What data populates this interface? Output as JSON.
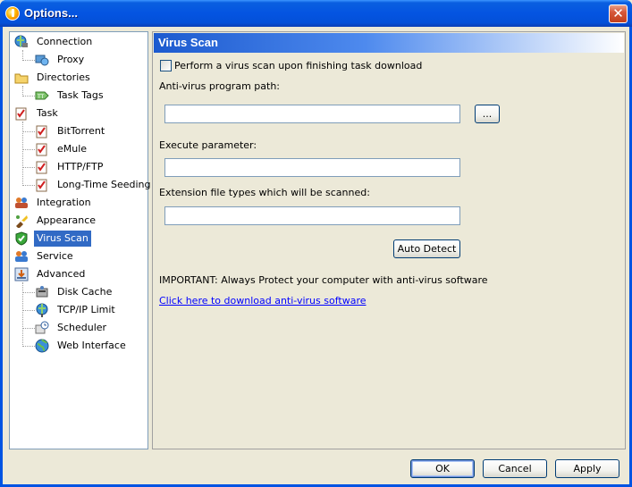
{
  "window": {
    "title": "Options..."
  },
  "tree": {
    "items": [
      {
        "label": "Connection",
        "icon": "connection-icon"
      },
      {
        "label": "Proxy",
        "icon": "proxy-icon"
      },
      {
        "label": "Directories",
        "icon": "folder-icon"
      },
      {
        "label": "Task Tags",
        "icon": "tag-icon"
      },
      {
        "label": "Task",
        "icon": "task-icon"
      },
      {
        "label": "BitTorrent",
        "icon": "task-icon"
      },
      {
        "label": "eMule",
        "icon": "task-icon"
      },
      {
        "label": "HTTP/FTP",
        "icon": "task-icon"
      },
      {
        "label": "Long-Time Seeding",
        "icon": "task-icon"
      },
      {
        "label": "Integration",
        "icon": "integration-icon"
      },
      {
        "label": "Appearance",
        "icon": "appearance-icon"
      },
      {
        "label": "Virus Scan",
        "icon": "shield-icon"
      },
      {
        "label": "Service",
        "icon": "service-icon"
      },
      {
        "label": "Advanced",
        "icon": "advanced-icon"
      },
      {
        "label": "Disk Cache",
        "icon": "disk-cache-icon"
      },
      {
        "label": "TCP/IP Limit",
        "icon": "network-icon"
      },
      {
        "label": "Scheduler",
        "icon": "scheduler-icon"
      },
      {
        "label": "Web Interface",
        "icon": "globe-icon"
      }
    ],
    "selected": "Virus Scan"
  },
  "panel": {
    "title": "Virus Scan",
    "scan_checkbox_label": "Perform a virus scan upon finishing task download",
    "scan_checked": false,
    "av_path_label": "Anti-virus program path:",
    "av_path_value": "",
    "browse_label": "...",
    "exec_param_label": "Execute parameter:",
    "exec_param_value": "",
    "ext_types_label": "Extension file types which will be scanned:",
    "ext_types_value": "",
    "auto_detect_label": "Auto Detect",
    "important_text": "IMPORTANT: Always Protect your computer with anti-virus software",
    "download_link": "Click here to download anti-virus software"
  },
  "footer": {
    "ok_label": "OK",
    "cancel_label": "Cancel",
    "apply_label": "Apply"
  }
}
